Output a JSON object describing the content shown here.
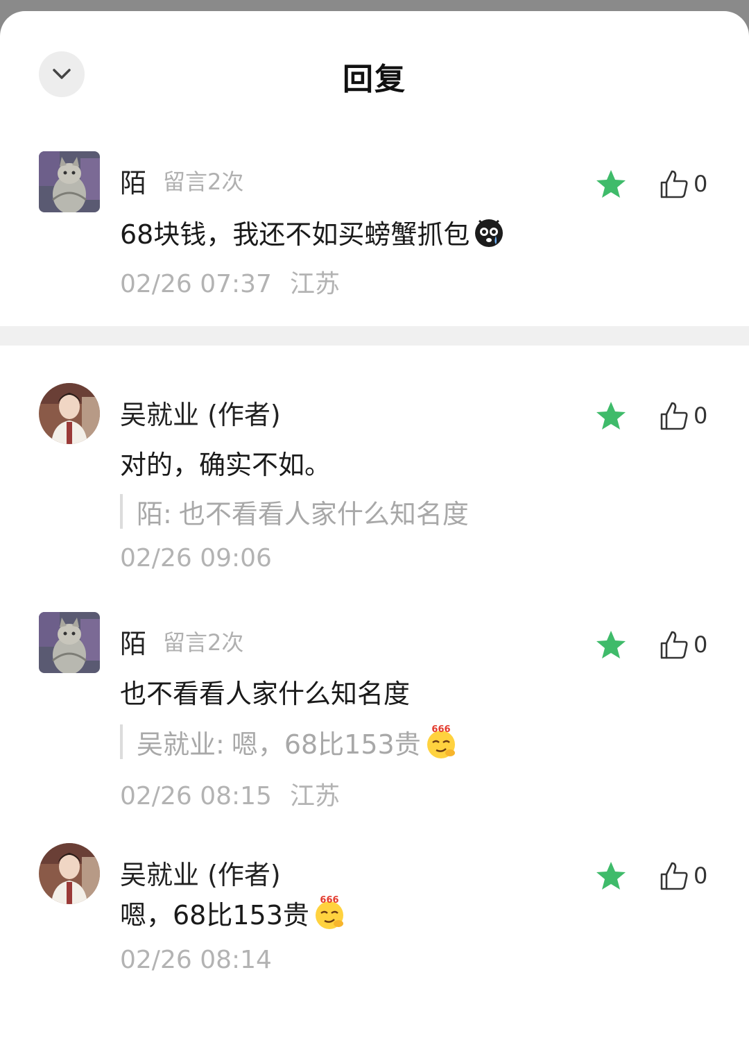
{
  "header": {
    "title": "回复"
  },
  "colors": {
    "accent_star": "#3fbb6a",
    "meta_gray": "#b0b0b0",
    "quote_bar": "#dcdcdc"
  },
  "top_comment": {
    "author": "陌",
    "meta": "留言2次",
    "text": "68块钱，我还不如买螃蟹抓包",
    "emoji": "crying-face-icon",
    "time": "02/26 07:37",
    "location": "江苏",
    "likes": "0"
  },
  "replies": [
    {
      "author": "吴就业 (作者)",
      "text": "对的，确实不如。",
      "quote_author": "陌:",
      "quote_text": "也不看看人家什么知名度",
      "time": "02/26 09:06",
      "likes": "0"
    },
    {
      "author": "陌",
      "meta": "留言2次",
      "text": "也不看看人家什么知名度",
      "quote_author": "吴就业:",
      "quote_text": "嗯，68比153贵",
      "quote_emoji_badge": "666",
      "time": "02/26 08:15",
      "location": "江苏",
      "likes": "0"
    },
    {
      "author": "吴就业 (作者)",
      "text": "嗯，68比153贵",
      "emoji_badge": "666",
      "time": "02/26 08:14",
      "likes": "0"
    }
  ]
}
